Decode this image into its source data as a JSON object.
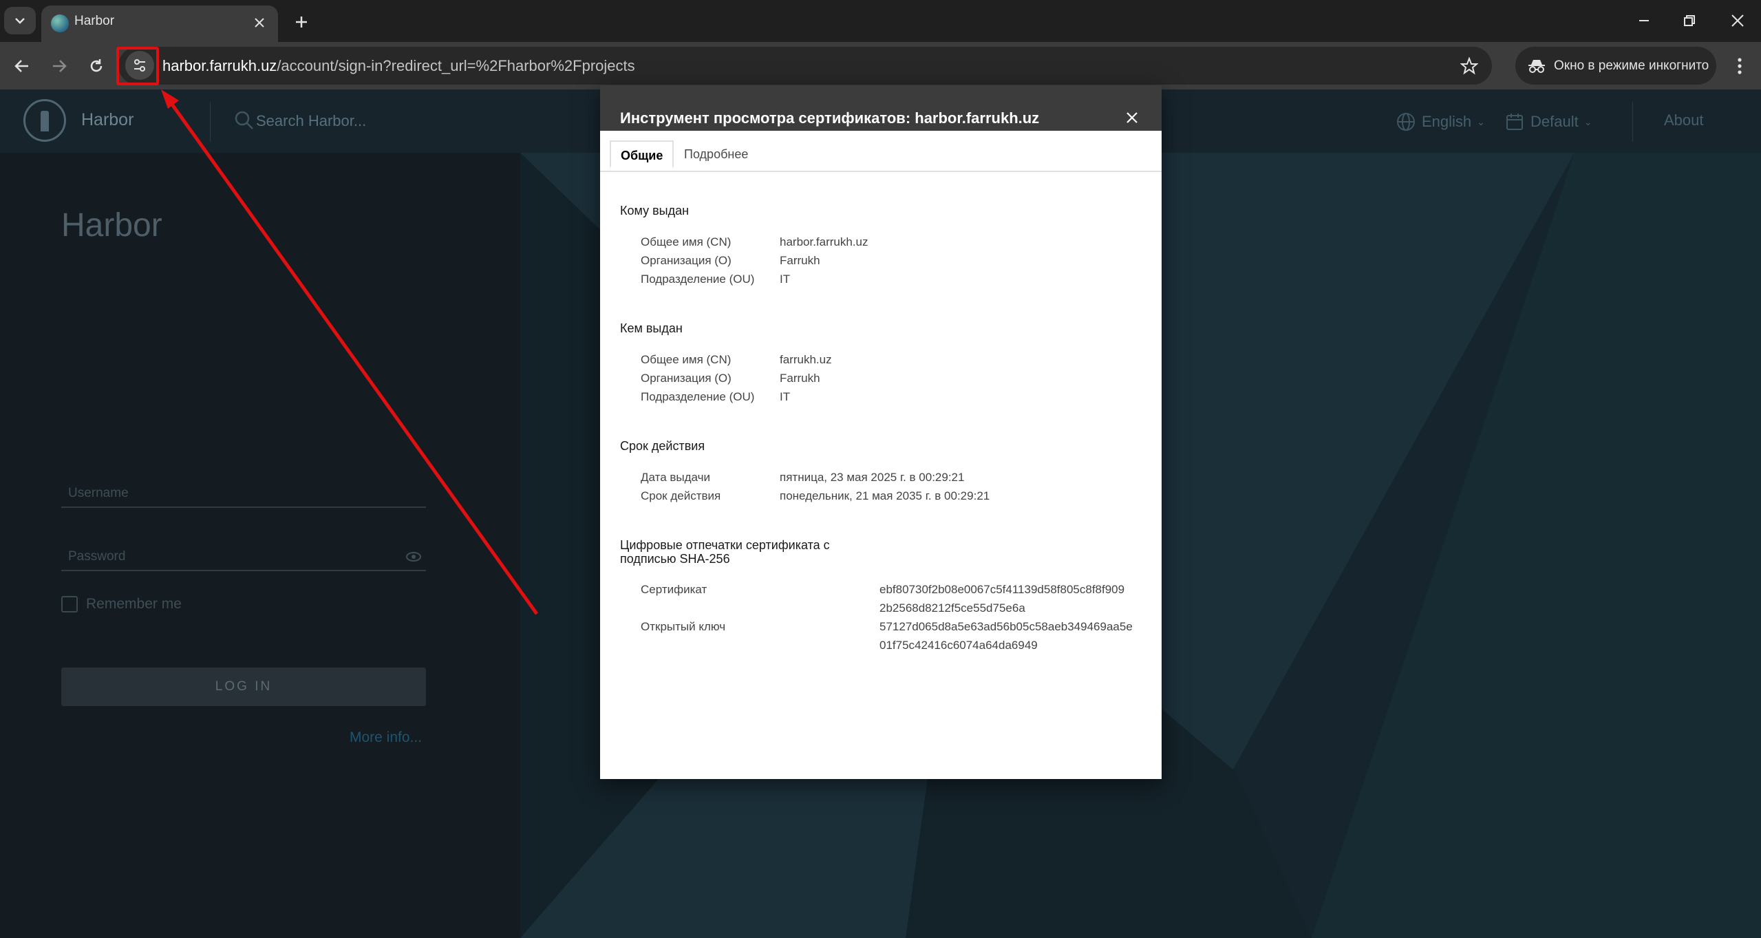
{
  "browser": {
    "tab_title": "Harbor",
    "url_host": "harbor.farrukh.uz",
    "url_path": "/account/sign-in?redirect_url=%2Fharbor%2Fprojects",
    "incognito_label": "Окно в режиме инкогнито"
  },
  "harbor": {
    "brand": "Harbor",
    "search_placeholder": "Search Harbor...",
    "language": "English",
    "theme": "Default",
    "about": "About",
    "login_title": "Harbor",
    "username_placeholder": "Username",
    "password_placeholder": "Password",
    "remember_me": "Remember me",
    "login_button": "LOG IN",
    "more_info": "More info..."
  },
  "dialog": {
    "title": "Инструмент просмотра сертификатов: harbor.farrukh.uz",
    "tabs": [
      "Общие",
      "Подробнее"
    ],
    "issued_to": {
      "heading": "Кому выдан",
      "rows": [
        {
          "label": "Общее имя (CN)",
          "value": "harbor.farrukh.uz"
        },
        {
          "label": "Организация (O)",
          "value": "Farrukh"
        },
        {
          "label": "Подразделение (OU)",
          "value": "IT"
        }
      ]
    },
    "issued_by": {
      "heading": "Кем выдан",
      "rows": [
        {
          "label": "Общее имя (CN)",
          "value": "farrukh.uz"
        },
        {
          "label": "Организация (O)",
          "value": "Farrukh"
        },
        {
          "label": "Подразделение (OU)",
          "value": "IT"
        }
      ]
    },
    "validity": {
      "heading": "Срок действия",
      "rows": [
        {
          "label": "Дата выдачи",
          "value": "пятница, 23 мая 2025 г. в 00:29:21"
        },
        {
          "label": "Срок действия",
          "value": "понедельник, 21 мая 2035 г. в 00:29:21"
        }
      ]
    },
    "fingerprints": {
      "heading_line1": "Цифровые отпечатки сертификата с",
      "heading_line2": "подписью SHA-256",
      "rows": [
        {
          "label": "Сертификат",
          "value_line1": "ebf80730f2b08e0067c5f41139d58f805c8f8f909",
          "value_line2": "2b2568d8212f5ce55d75e6a"
        },
        {
          "label": "Открытый ключ",
          "value_line1": "57127d065d8a5e63ad56b05c58aeb349469aa5e",
          "value_line2": "01f75c42416c6074a64da6949"
        }
      ]
    }
  },
  "colors": {
    "annotation_red": "#e01010",
    "harbor_link": "#1c5570"
  }
}
